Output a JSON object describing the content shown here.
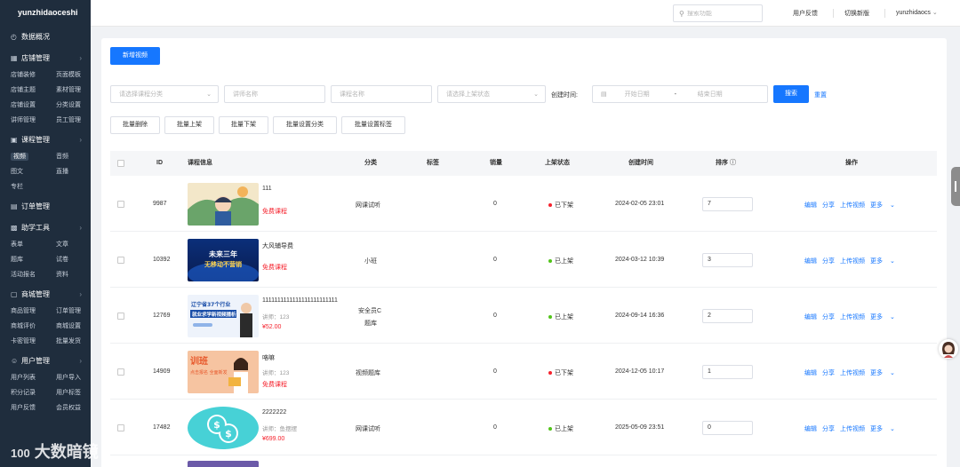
{
  "sidebar": {
    "brand": "yunzhidaoceshi",
    "groups": [
      {
        "title": "数据概况",
        "icon": "clock-icon",
        "items": []
      },
      {
        "title": "店铺管理",
        "icon": "shop-icon",
        "items": [
          "店铺装修",
          "页面模板",
          "店铺主题",
          "素材管理",
          "店铺设置",
          "分类设置",
          "讲师管理",
          "员工管理"
        ]
      },
      {
        "title": "课程管理",
        "icon": "book-icon",
        "items": [
          "视频",
          "音频",
          "图文",
          "直播",
          "专栏"
        ]
      },
      {
        "title": "订单管理",
        "icon": "list-icon",
        "items": []
      },
      {
        "title": "助学工具",
        "icon": "briefcase-icon",
        "items": [
          "表单",
          "文章",
          "题库",
          "试卷",
          "活动报名",
          "资料"
        ]
      },
      {
        "title": "商城管理",
        "icon": "store-icon",
        "items": [
          "商品管理",
          "订单管理",
          "商城评价",
          "商城设置",
          "卡密管理",
          "批量发货"
        ]
      },
      {
        "title": "用户管理",
        "icon": "user-icon",
        "items": [
          "用户列表",
          "用户导入",
          "积分记录",
          "用户标签",
          "用户反馈",
          "会员权益"
        ]
      }
    ]
  },
  "topbar": {
    "search_placeholder": "搜索功能",
    "feedback": "用户反馈",
    "switch_new": "切换新版",
    "account": "yunzhidaocs"
  },
  "toolbar": {
    "add_video": "新增视频",
    "filters": {
      "category_placeholder": "请选择课程分类",
      "lecturer_placeholder": "讲师名称",
      "course_placeholder": "课程名称",
      "status_placeholder": "请选择上架状态",
      "created_label": "创建时间:",
      "start_date_placeholder": "开始日期",
      "date_sep": "-",
      "end_date_placeholder": "结束日期",
      "search": "搜索",
      "reset": "重置"
    },
    "batch": [
      "批量删除",
      "批量上架",
      "批量下架",
      "批量设置分类",
      "批量设置标签"
    ]
  },
  "table": {
    "headers": {
      "id": "ID",
      "info": "课程信息",
      "category": "分类",
      "tag": "标签",
      "sales": "销量",
      "status": "上架状态",
      "created": "创建时间",
      "sort": "排序",
      "ops": "操作"
    },
    "ops_labels": [
      "编辑",
      "分享",
      "上传视频",
      "更多"
    ],
    "rows": [
      {
        "id": "9987",
        "title": "111",
        "lecturer": "",
        "price_label": "免费课程",
        "paid": false,
        "category": "网课试听",
        "category2": "",
        "sales": "0",
        "status": "已下架",
        "on_shelf": false,
        "created": "2024-02-05 23:01",
        "sort": "7",
        "thumb": "cartoon"
      },
      {
        "id": "10392",
        "title": "大风辅导费",
        "lecturer": "",
        "price_label": "免费课程",
        "paid": false,
        "category": "小班",
        "category2": "",
        "sales": "0",
        "status": "已上架",
        "on_shelf": true,
        "created": "2024-03-12 10:39",
        "sort": "3",
        "thumb": "blue"
      },
      {
        "id": "12769",
        "title": "1111111111111111111111111",
        "lecturer": "讲师：123",
        "price_label": "¥52.00",
        "paid": true,
        "category": "安全员C",
        "category2": "题库",
        "sales": "0",
        "status": "已上架",
        "on_shelf": true,
        "created": "2024-09-14 16:36",
        "sort": "2",
        "thumb": "promo"
      },
      {
        "id": "14909",
        "title": "咯嘛",
        "lecturer": "讲师：123",
        "price_label": "免费课程",
        "paid": false,
        "category": "视频题库",
        "category2": "",
        "sales": "0",
        "status": "已下架",
        "on_shelf": false,
        "created": "2024-12-05 10:17",
        "sort": "1",
        "thumb": "orange"
      },
      {
        "id": "17482",
        "title": "2222222",
        "lecturer": "讲师：鱼摆摆",
        "price_label": "¥699.00",
        "paid": true,
        "category": "网课试听",
        "category2": "",
        "sales": "0",
        "status": "已上架",
        "on_shelf": true,
        "created": "2025-05-09 23:51",
        "sort": "0",
        "thumb": "coin"
      }
    ]
  },
  "thumb_text": {
    "blue_line1": "未来三年",
    "blue_line2": "无移动不营销",
    "promo_line1": "辽宁省37个行业",
    "promo_line2": "就业求学新视频播析",
    "orange_line1": "训班",
    "orange_line2": "点击报名 全面新发"
  },
  "colors": {
    "primary": "#1677ff",
    "danger": "#f5222d",
    "on": "#52c41a",
    "off": "#f5222d",
    "sidebar": "#1f2d3d"
  },
  "watermark": "大数暗镜",
  "watermark_logo": "100"
}
